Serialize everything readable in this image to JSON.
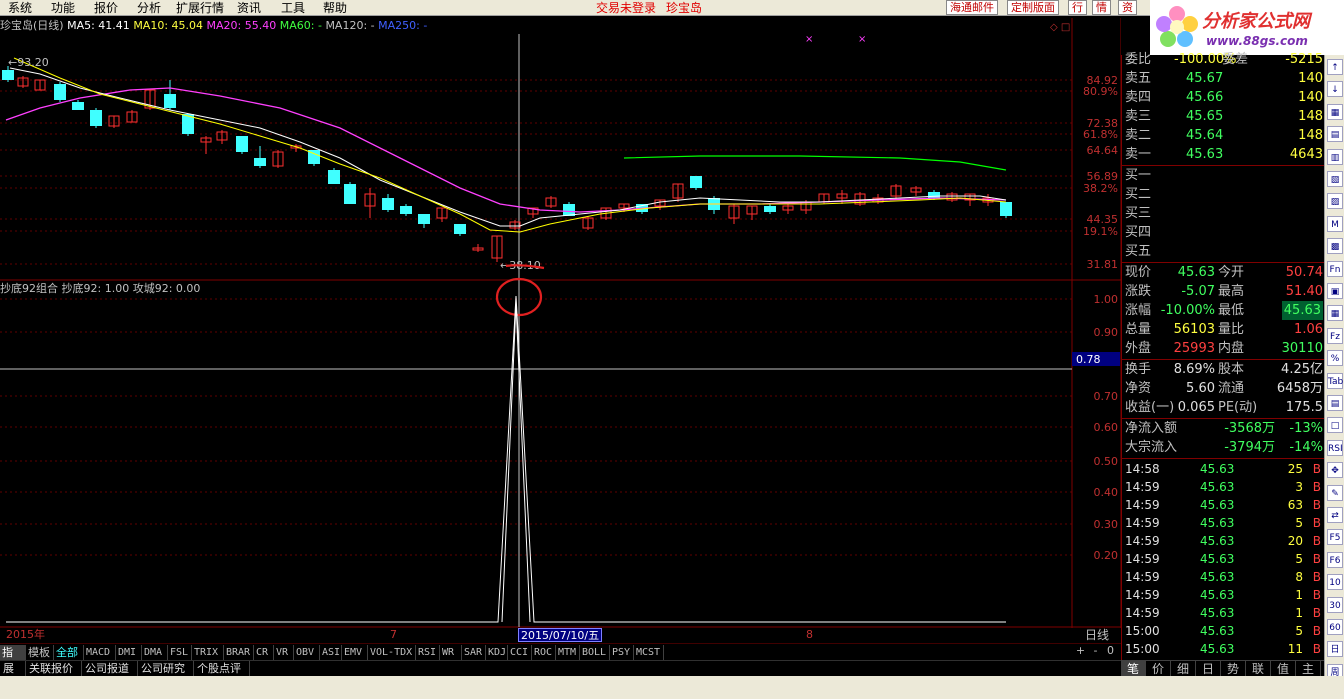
{
  "menu": {
    "items": [
      "系统",
      "功能",
      "报价",
      "分析",
      "扩展行情",
      "资讯",
      "工具",
      "帮助"
    ],
    "status_login": "交易未登录",
    "status_stock": "珍宝岛",
    "right_buttons": [
      "海通邮件",
      "定制版面",
      "行",
      "情",
      "资"
    ]
  },
  "logo": {
    "title": "分析家公式网",
    "url": "www.88gs.com"
  },
  "chart_header": {
    "stock": "珍宝岛(日线)",
    "ma5": "MA5: 41.41",
    "ma10": "MA10: 45.04",
    "ma20": "MA20: 55.40",
    "ma60": "MA60: -",
    "ma120": "MA120: -",
    "ma250": "MA250: -",
    "high_label": "93.20",
    "low_label": "38.10"
  },
  "indicator_header": {
    "name": "抄底92组合",
    "v1": "抄底92: 1.00",
    "v2": "攻城92: 0.00",
    "cursor_value": "0.78"
  },
  "date_axis": {
    "labels": [
      "2015年",
      "7",
      "8"
    ],
    "cursor": "2015/07/10/五",
    "period": "日线"
  },
  "indicator_tabs": [
    "指标",
    "模板",
    "全部",
    "MACD",
    "DMI",
    "DMA",
    "FSL",
    "TRIX",
    "BRAR",
    "CR",
    "VR",
    "OBV",
    "ASI",
    "EMV",
    "VOL-TDX",
    "RSI",
    "WR",
    "SAR",
    "KDJ",
    "CCI",
    "ROC",
    "MTM",
    "BOLL",
    "PSY",
    "MCST"
  ],
  "zoom_buttons": [
    "+",
    "-",
    "0"
  ],
  "bottom_tabs": [
    "展八",
    "关联报价",
    "公司报道",
    "公司研究",
    "个股点评"
  ],
  "order_book": {
    "header": {
      "l1": "委比",
      "v1": "-100.00%",
      "l2": "委差",
      "v2": "-5215"
    },
    "sell": [
      {
        "label": "卖五",
        "price": "45.67",
        "vol": "140"
      },
      {
        "label": "卖四",
        "price": "45.66",
        "vol": "140"
      },
      {
        "label": "卖三",
        "price": "45.65",
        "vol": "148"
      },
      {
        "label": "卖二",
        "price": "45.64",
        "vol": "148"
      },
      {
        "label": "卖一",
        "price": "45.63",
        "vol": "4643"
      }
    ],
    "buy": [
      {
        "label": "买一"
      },
      {
        "label": "买二"
      },
      {
        "label": "买三"
      },
      {
        "label": "买四"
      },
      {
        "label": "买五"
      }
    ]
  },
  "quote": [
    {
      "l1": "现价",
      "v1": "45.63",
      "l2": "今开",
      "v2": "50.74"
    },
    {
      "l1": "涨跌",
      "v1": "-5.07",
      "l2": "最高",
      "v2": "51.40"
    },
    {
      "l1": "涨幅",
      "v1": "-10.00%",
      "l2": "最低",
      "v2": "45.63"
    },
    {
      "l1": "总量",
      "v1": "56103",
      "l2": "量比",
      "v2": "1.06"
    },
    {
      "l1": "外盘",
      "v1": "25993",
      "l2": "内盘",
      "v2": "30110"
    },
    {
      "l1": "换手",
      "v1": "8.69%",
      "l2": "股本",
      "v2": "4.25亿"
    },
    {
      "l1": "净资",
      "v1": "5.60",
      "l2": "流通",
      "v2": "6458万"
    },
    {
      "l1": "收益(一)",
      "v1": "0.065",
      "l2": "PE(动)",
      "v2": "175.5"
    }
  ],
  "flows": [
    {
      "label": "净流入额",
      "value": "-3568万",
      "pct": "-13%"
    },
    {
      "label": "大宗流入",
      "value": "-3794万",
      "pct": "-14%"
    }
  ],
  "ticks": [
    {
      "time": "14:58",
      "price": "45.63",
      "vol": "25",
      "side": "B"
    },
    {
      "time": "14:59",
      "price": "45.63",
      "vol": "3",
      "side": "B"
    },
    {
      "time": "14:59",
      "price": "45.63",
      "vol": "63",
      "side": "B"
    },
    {
      "time": "14:59",
      "price": "45.63",
      "vol": "5",
      "side": "B"
    },
    {
      "time": "14:59",
      "price": "45.63",
      "vol": "20",
      "side": "B"
    },
    {
      "time": "14:59",
      "price": "45.63",
      "vol": "5",
      "side": "B"
    },
    {
      "time": "14:59",
      "price": "45.63",
      "vol": "8",
      "side": "B"
    },
    {
      "time": "14:59",
      "price": "45.63",
      "vol": "1",
      "side": "B"
    },
    {
      "time": "14:59",
      "price": "45.63",
      "vol": "1",
      "side": "B"
    },
    {
      "time": "15:00",
      "price": "45.63",
      "vol": "5",
      "side": "B"
    },
    {
      "time": "15:00",
      "price": "45.63",
      "vol": "11",
      "side": "B"
    }
  ],
  "right_tabs": [
    "笔",
    "价",
    "细",
    "日",
    "势",
    "联",
    "值",
    "主"
  ],
  "side_icons": [
    "↑",
    "↓",
    "▦",
    "▤",
    "▥",
    "▧",
    "▨",
    "M",
    "▩",
    "Fn",
    "▣",
    "▦",
    "Fz",
    "%",
    "Tab",
    "▤",
    "□",
    "RSI",
    "✥",
    "✎",
    "⇄",
    "F5",
    "F6",
    "10",
    "30",
    "60",
    "日",
    "周"
  ],
  "price_axis": [
    "84.92",
    "80.9%",
    "72.38",
    "61.8%",
    "64.64",
    "56.89",
    "38.2%",
    "44.35",
    "19.1%",
    "31.81"
  ],
  "ind_axis": [
    "1.00",
    "0.90",
    "0.70",
    "0.60",
    "0.50",
    "0.40",
    "0.30",
    "0.20"
  ],
  "colors": {
    "up": "#ff3030",
    "down": "#40ffff",
    "ma5": "#ffffff",
    "ma10": "#ffff00",
    "ma20": "#ff40ff",
    "ma60": "#00ff00",
    "grid": "#800000"
  }
}
